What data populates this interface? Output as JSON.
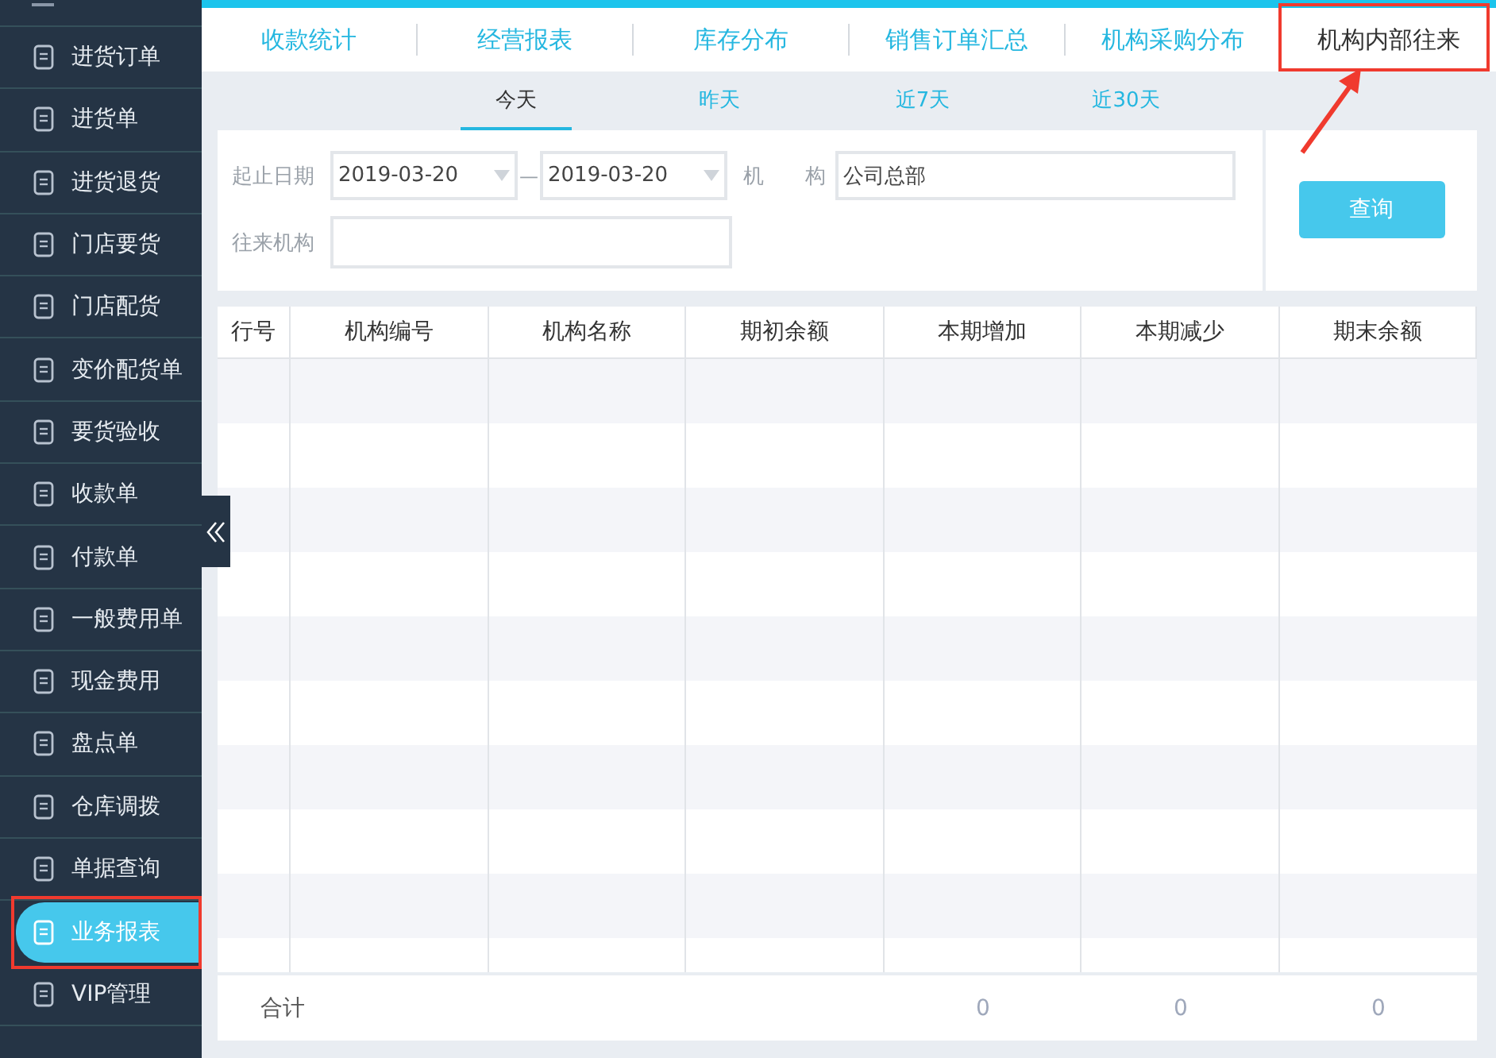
{
  "sidebar": {
    "items": [
      {
        "label": "进货订单",
        "selected": false,
        "highlighted": false
      },
      {
        "label": "进货单",
        "selected": false,
        "highlighted": false
      },
      {
        "label": "进货退货",
        "selected": false,
        "highlighted": false
      },
      {
        "label": "门店要货",
        "selected": false,
        "highlighted": false
      },
      {
        "label": "门店配货",
        "selected": false,
        "highlighted": false
      },
      {
        "label": "变价配货单",
        "selected": false,
        "highlighted": false
      },
      {
        "label": "要货验收",
        "selected": false,
        "highlighted": false
      },
      {
        "label": "收款单",
        "selected": false,
        "highlighted": false
      },
      {
        "label": "付款单",
        "selected": false,
        "highlighted": false
      },
      {
        "label": "一般费用单",
        "selected": false,
        "highlighted": false
      },
      {
        "label": "现金费用",
        "selected": false,
        "highlighted": false
      },
      {
        "label": "盘点单",
        "selected": false,
        "highlighted": false
      },
      {
        "label": "仓库调拨",
        "selected": false,
        "highlighted": false
      },
      {
        "label": "单据查询",
        "selected": false,
        "highlighted": false
      },
      {
        "label": "业务报表",
        "selected": true,
        "highlighted": true
      },
      {
        "label": "VIP管理",
        "selected": false,
        "highlighted": false
      }
    ]
  },
  "report_tabs": [
    {
      "label": "收款统计",
      "selected": false,
      "highlighted": false
    },
    {
      "label": "经营报表",
      "selected": false,
      "highlighted": false
    },
    {
      "label": "库存分布",
      "selected": false,
      "highlighted": false
    },
    {
      "label": "销售订单汇总",
      "selected": false,
      "highlighted": false
    },
    {
      "label": "机构采购分布",
      "selected": false,
      "highlighted": false
    },
    {
      "label": "机构内部往来",
      "selected": true,
      "highlighted": true
    }
  ],
  "date_tabs": [
    {
      "label": "今天",
      "selected": true
    },
    {
      "label": "昨天",
      "selected": false
    },
    {
      "label": "近7天",
      "selected": false
    },
    {
      "label": "近30天",
      "selected": false
    }
  ],
  "filters": {
    "date_label": "起止日期",
    "start_date": "2019-03-20",
    "separator": "—",
    "end_date": "2019-03-20",
    "org_label_1": "机",
    "org_label_2": "构",
    "org_value": "公司总部",
    "partner_label": "往来机构",
    "query_button": "查询"
  },
  "table": {
    "columns": [
      "行号",
      "机构编号",
      "机构名称",
      "期初余额",
      "本期增加",
      "本期减少",
      "期末余额"
    ],
    "footer": {
      "label": "合计",
      "values": [
        "0",
        "0",
        "0"
      ]
    }
  }
}
